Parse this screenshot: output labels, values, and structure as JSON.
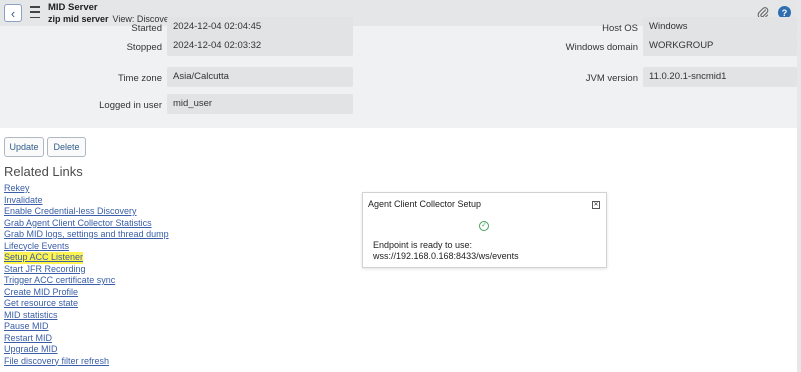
{
  "header": {
    "title": "MID Server",
    "record": "zip mid server",
    "view": "View: Discovery",
    "back_icon": "chevron-left-icon",
    "menu_icon": "hamburger-menu-icon",
    "attach_icon": "paperclip-icon",
    "help_icon": "help-circle-icon"
  },
  "form": {
    "started_label": "Started",
    "started_value": "2024-12-04 02:04:45",
    "stopped_label": "Stopped",
    "stopped_value": "2024-12-04 02:03:32",
    "timezone_label": "Time zone",
    "timezone_value": "Asia/Calcutta",
    "logged_label": "Logged in user",
    "logged_value": "mid_user",
    "hostos_label": "Host OS",
    "hostos_value": "Windows",
    "domain_label": "Windows domain",
    "domain_value": "WORKGROUP",
    "jvm_label": "JVM version",
    "jvm_value": "11.0.20.1-sncmid1"
  },
  "actions": {
    "update": "Update",
    "delete": "Delete"
  },
  "related": {
    "title": "Related Links",
    "links": [
      "Rekey",
      "Invalidate",
      "Enable Credential-less Discovery",
      "Grab Agent Client Collector Statistics",
      "Grab MID logs, settings and thread dump",
      "Lifecycle Events",
      "Setup ACC Listener",
      "Start JFR Recording",
      "Trigger ACC certificate sync",
      "Create MID Profile",
      "Get resource state",
      "MID statistics",
      "Pause MID",
      "Restart MID",
      "Upgrade MID",
      "File discovery filter refresh"
    ]
  },
  "dialog": {
    "title": "Agent Client Collector Setup",
    "message_line1": "Endpoint is ready to use:",
    "message_line2": "wss://192.168.0.168:8433/ws/events",
    "close_icon": "close-box-icon",
    "status_icon": "check-circle-icon"
  },
  "colors": {
    "link": "#3a5ea8",
    "highlight": "#fff44f",
    "success": "#47a05a",
    "help_badge": "#2f6fb1"
  }
}
